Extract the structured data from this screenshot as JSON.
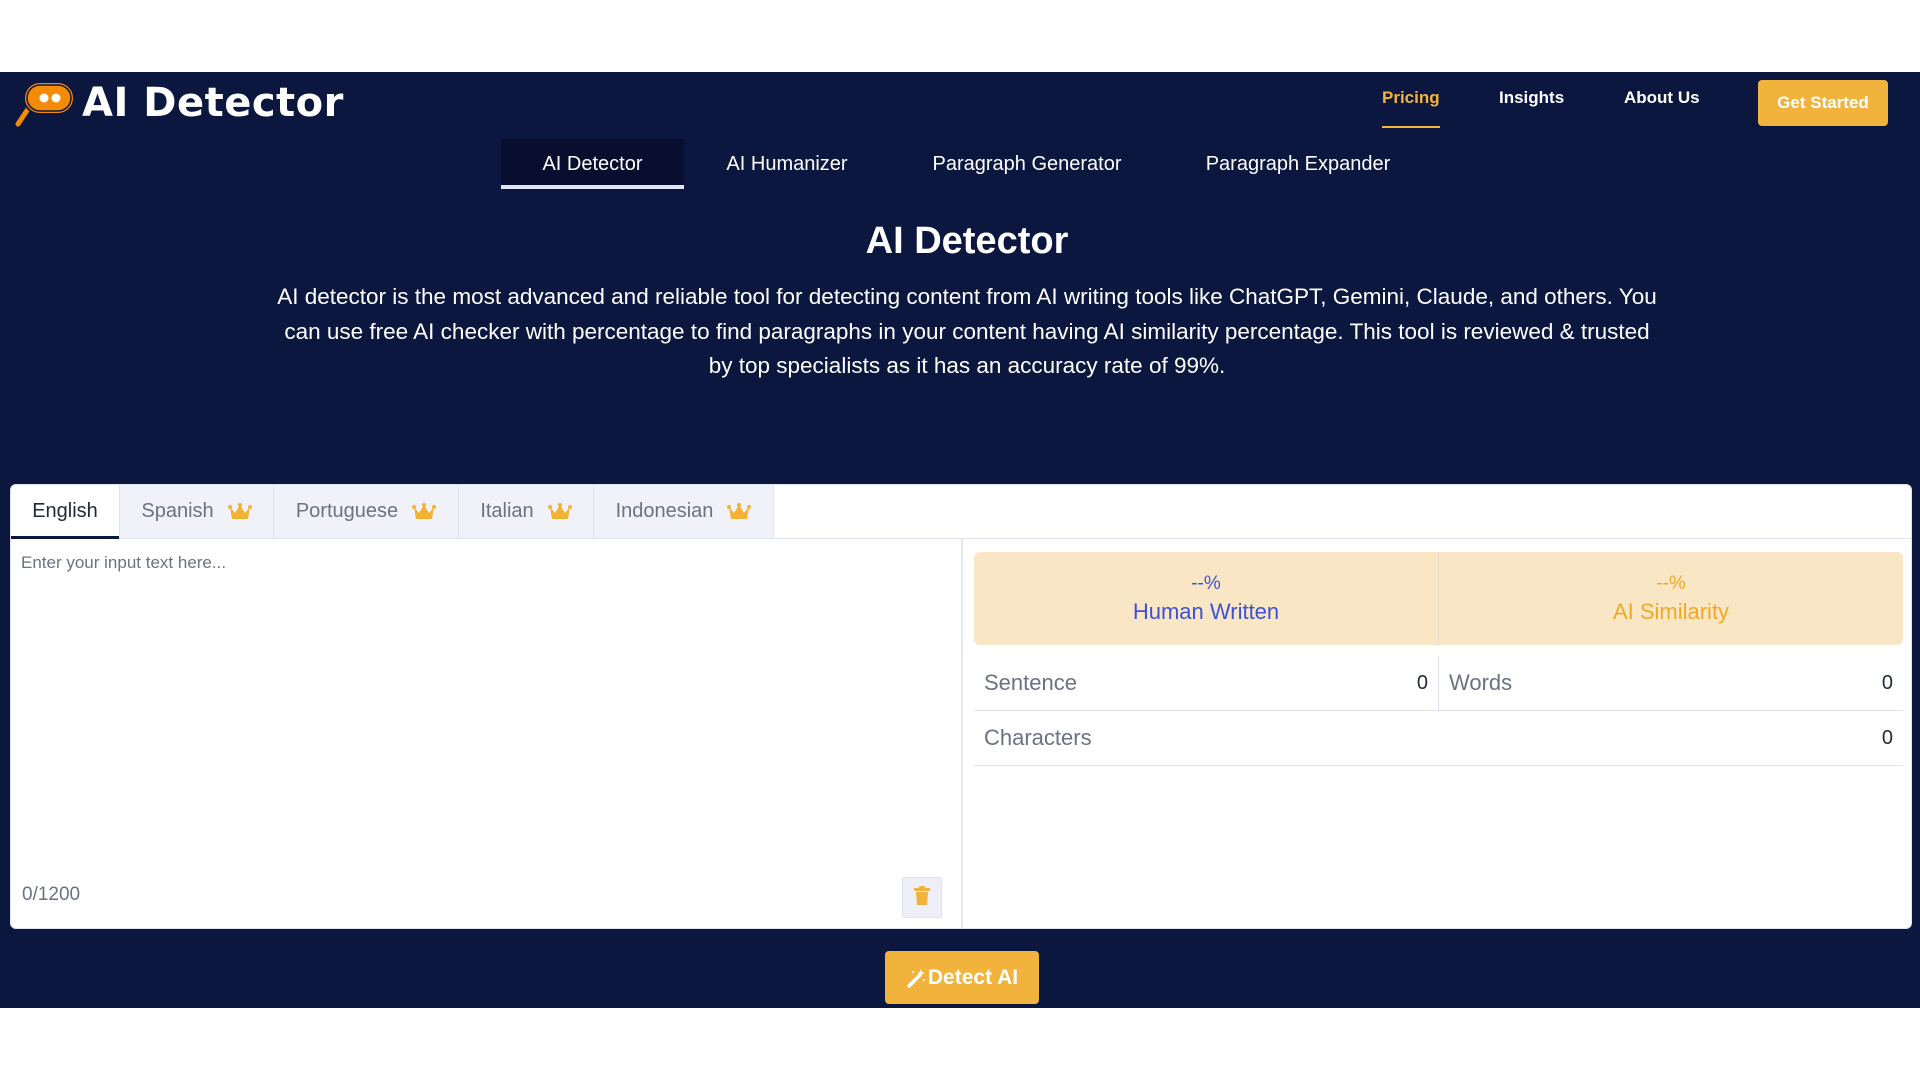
{
  "header": {
    "logo_text": "AI Detector",
    "nav": [
      {
        "label": "Pricing",
        "active": true
      },
      {
        "label": "Insights",
        "active": false
      },
      {
        "label": "About Us",
        "active": false
      }
    ],
    "cta_label": "Get Started"
  },
  "tool_tabs": [
    {
      "label": "AI Detector",
      "active": true
    },
    {
      "label": "AI Humanizer",
      "active": false
    },
    {
      "label": "Paragraph Generator",
      "active": false
    },
    {
      "label": "Paragraph Expander",
      "active": false
    }
  ],
  "hero": {
    "title": "AI Detector",
    "description": "AI detector is the most advanced and reliable tool for detecting content from AI writing tools like ChatGPT, Gemini, Claude, and others. You can use free AI checker with percentage to find paragraphs in your content having AI similarity percentage. This tool is reviewed & trusted by top specialists as it has an accuracy rate of 99%."
  },
  "language_tabs": [
    {
      "label": "English",
      "active": true,
      "premium": false
    },
    {
      "label": "Spanish",
      "active": false,
      "premium": true
    },
    {
      "label": "Portuguese",
      "active": false,
      "premium": true
    },
    {
      "label": "Italian",
      "active": false,
      "premium": true
    },
    {
      "label": "Indonesian",
      "active": false,
      "premium": true
    }
  ],
  "input": {
    "value": "",
    "placeholder": "Enter your input text here...",
    "counter": "0/1200"
  },
  "results": {
    "human": {
      "value": "--%",
      "label": "Human Written"
    },
    "ai": {
      "value": "--%",
      "label": "AI Similarity"
    }
  },
  "stats": {
    "sentence": {
      "label": "Sentence",
      "value": "0"
    },
    "words": {
      "label": "Words",
      "value": "0"
    },
    "characters": {
      "label": "Characters",
      "value": "0"
    }
  },
  "detect_button_label": "Detect AI",
  "colors": {
    "background": "#0c1740",
    "accent": "#f1b33b",
    "human": "#3d52d5",
    "ai": "#f3a823",
    "result_panel": "#f9e6c5"
  }
}
